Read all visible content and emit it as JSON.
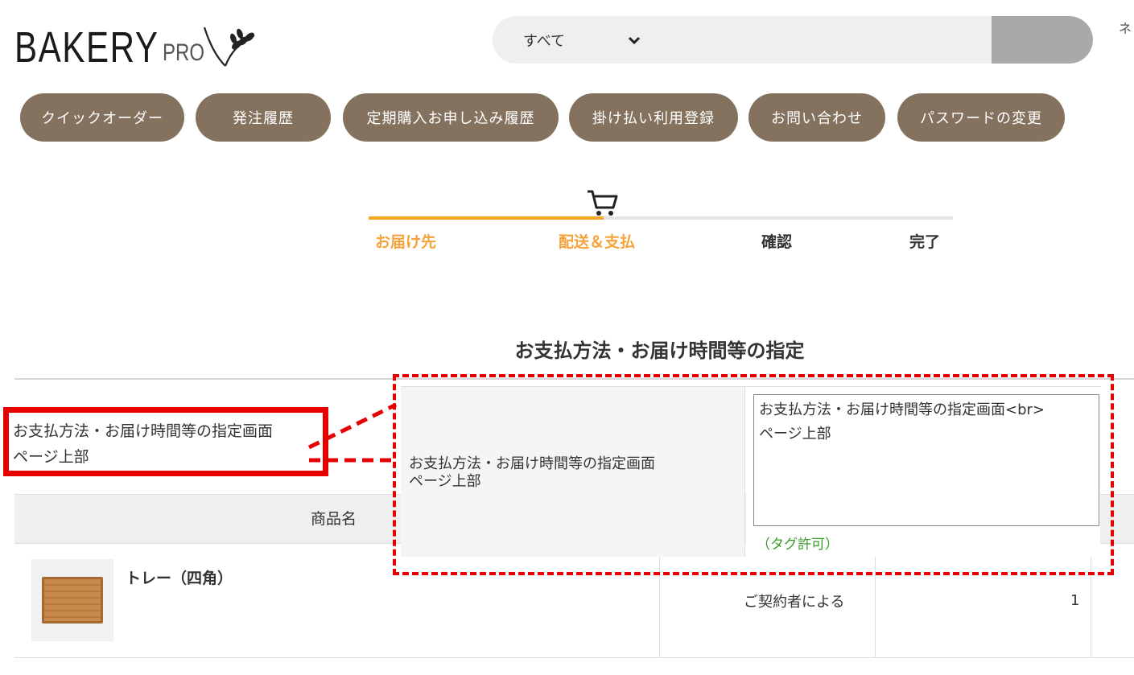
{
  "header": {
    "logo_main": "BAKERY",
    "logo_sub": "PRO",
    "search_category": "すべて",
    "right_text": "ネ"
  },
  "nav": [
    {
      "label": "クイックオーダー"
    },
    {
      "label": "発注履歴"
    },
    {
      "label": "定期購入お申し込み履歴"
    },
    {
      "label": "掛け払い利用登録"
    },
    {
      "label": "お問い合わせ"
    },
    {
      "label": "パスワードの変更"
    }
  ],
  "steps": [
    {
      "label": "お届け先",
      "state": "active"
    },
    {
      "label": "配送＆支払",
      "state": "active"
    },
    {
      "label": "確認",
      "state": "inactive"
    },
    {
      "label": "完了",
      "state": "inactive"
    }
  ],
  "progress": {
    "fraction": 0.4
  },
  "page": {
    "title": "お支払方法・お届け時間等の指定"
  },
  "annotation": {
    "left_line1": "お支払方法・お届け時間等の指定画面",
    "left_line2": "ページ上部"
  },
  "admin": {
    "label_line1": "お支払方法・お届け時間等の指定画面",
    "label_line2": "ページ上部",
    "textarea_value": "お支払方法・お届け時間等の指定画面<br>\nページ上部",
    "hint": "（タグ許可）"
  },
  "table": {
    "header_name": "商品名",
    "rows": [
      {
        "name": "トレー（四角）",
        "price": "ご契約者による",
        "qty": "1"
      }
    ]
  },
  "colors": {
    "nav_pill": "#84725f",
    "step_active": "#f5a33a",
    "annotation_red": "#e60000",
    "hint_green": "#3a9a2a"
  }
}
